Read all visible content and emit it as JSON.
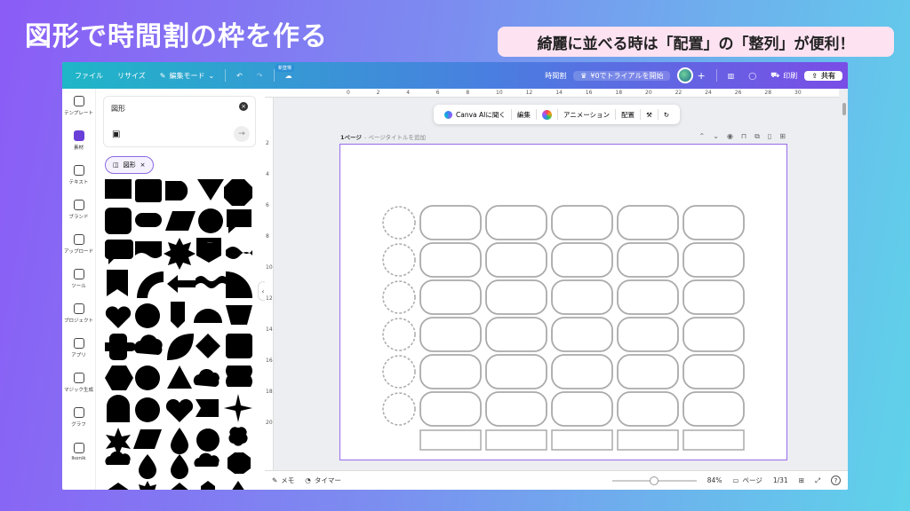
{
  "headline": "図形で時間割の枠を作る",
  "callout": "綺麗に並べる時は「配置」の「整列」が便利！",
  "topbar": {
    "file": "ファイル",
    "resize": "リサイズ",
    "edit_mode": "編集モード",
    "new_badge": "新登場",
    "doc_title": "時間割",
    "trial": "¥0でトライアルを開始",
    "print": "印刷",
    "share": "共有"
  },
  "rail": [
    {
      "label": "テンプレート"
    },
    {
      "label": "素材"
    },
    {
      "label": "テキスト"
    },
    {
      "label": "ブランド"
    },
    {
      "label": "アップロード"
    },
    {
      "label": "ツール"
    },
    {
      "label": "プロジェクト"
    },
    {
      "label": "アプリ"
    },
    {
      "label": "マジック生成"
    },
    {
      "label": "グラフ"
    },
    {
      "label": "Ikonik"
    }
  ],
  "panel": {
    "search_value": "図形",
    "chip": "図形"
  },
  "ruler": {
    "top": [
      "0",
      "2",
      "4",
      "6",
      "8",
      "10",
      "12",
      "14",
      "16",
      "18",
      "20",
      "22",
      "24",
      "26",
      "28",
      "30"
    ],
    "left": [
      "2",
      "4",
      "6",
      "8",
      "10",
      "12",
      "14",
      "16",
      "18",
      "20"
    ]
  },
  "context_toolbar": {
    "ai": "Canva AIに聞く",
    "edit": "編集",
    "animation": "アニメーション",
    "position": "配置"
  },
  "pagebar": {
    "page": "1ページ",
    "title_placeholder": "- ページタイトルを追加"
  },
  "bottombar": {
    "notes": "メモ",
    "timer": "タイマー",
    "zoom": "84%",
    "pages": "ページ",
    "page_count": "1/31"
  },
  "colors": {
    "accent": "#8b5cf6",
    "selection": "#9a6bea"
  }
}
